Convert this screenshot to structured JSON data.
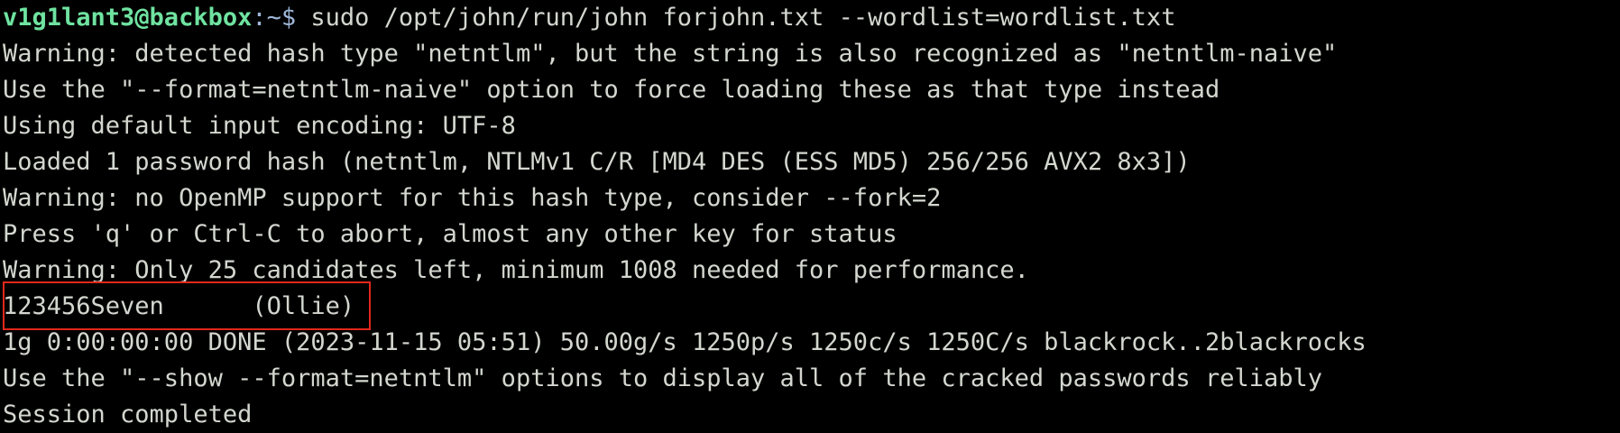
{
  "terminal": {
    "prompt_user_host": "v1g1lant3@backbox",
    "prompt_path": ":~$",
    "command": " sudo /opt/john/run/john forjohn.txt --wordlist=wordlist.txt",
    "output_lines": [
      "Warning: detected hash type \"netntlm\", but the string is also recognized as \"netntlm-naive\"",
      "Use the \"--format=netntlm-naive\" option to force loading these as that type instead",
      "Using default input encoding: UTF-8",
      "Loaded 1 password hash (netntlm, NTLMv1 C/R [MD4 DES (ESS MD5) 256/256 AVX2 8x3])",
      "Warning: no OpenMP support for this hash type, consider --fork=2",
      "Press 'q' or Ctrl-C to abort, almost any other key for status",
      "Warning: Only 25 candidates left, minimum 1008 needed for performance.",
      "123456Seven      (Ollie)",
      "1g 0:00:00:00 DONE (2023-11-15 05:51) 50.00g/s 1250p/s 1250c/s 1250C/s blackrock..2blackrocks",
      "Use the \"--show --format=netntlm\" options to display all of the cracked passwords reliably",
      "Session completed"
    ],
    "colors": {
      "prompt": "#6fe3a0",
      "text": "#d3d7cf",
      "highlight_box": "#e0281b",
      "background": "#000000"
    }
  }
}
